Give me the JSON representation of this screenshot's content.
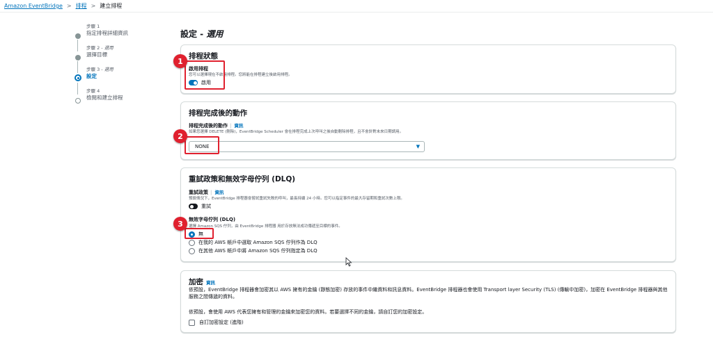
{
  "breadcrumb": {
    "service": "Amazon EventBridge",
    "section": "排程",
    "current": "建立排程",
    "separator": ">"
  },
  "steps": [
    {
      "step": "步驟 1",
      "title": "指定排程詳細資訊",
      "optional": ""
    },
    {
      "step": "步驟 2 - ",
      "title": "選擇目標",
      "optional": "選用"
    },
    {
      "step": "步驟 3 - ",
      "title": "設定",
      "optional": "選用"
    },
    {
      "step": "步驟 4",
      "title": "檢閱和建立排程",
      "optional": ""
    }
  ],
  "page": {
    "title": "設定 - ",
    "title_optional": "選用"
  },
  "schedule_state": {
    "heading": "排程狀態",
    "label": "啟用排程",
    "description": "您可以選擇現在不啟用排程。您將能在排程建立後啟用排程。",
    "toggle_label": "啟用",
    "enabled": true
  },
  "completion_action": {
    "heading": "排程完成後的動作",
    "label": "排程完成後的動作",
    "info": "資訊",
    "description": "如果您選擇 DELETE (刪除)，EventBridge Scheduler 會在排程完成上次呼叫之後自動刪除排程，且不會針對未來日期調用。",
    "selected": "NONE"
  },
  "retry_dlq": {
    "heading": "重試政策和無效字母佇列 (DLQ)",
    "retry_label": "重試政策",
    "info": "資訊",
    "retry_description": "預設情況下，EventBridge 排程器會嘗試重試失敗的呼叫，最長持續 24 小時。您可以指定事件的最大存留期和重試次數上限。",
    "retry_toggle": "重試",
    "retry_enabled": false,
    "dlq_label": "無效字母佇列 (DLQ)",
    "dlq_description": "選擇 Amazon SQS 佇列，由 EventBridge 排程器 用於存放無法成功傳遞至目標的事件。",
    "options": [
      "無",
      "在我的 AWS 帳戶中選取 Amazon SQS 佇列作為 DLQ",
      "在其他 AWS 帳戶中將 Amazon SQS 佇列指定為 DLQ"
    ],
    "selected_index": 0
  },
  "encryption": {
    "heading": "加密",
    "info": "資訊",
    "paragraph1": "依預設，EventBridge 排程器會加密其以 AWS 擁有的金鑰 (靜態加密) 存放的事件中繼資料和訊息資料。EventBridge 排程器也會使用 Transport layer Security (TLS) (傳輸中加密)，加密在 EventBridge 排程器與其他服務之間傳遞的資料。",
    "paragraph2": "依預設，會使用 AWS 代表您擁有和管理的金鑰來加密您的資料。若要選擇不同的金鑰，請自訂您的加密設定。",
    "checkbox_label": "自訂加密設定 (進階)"
  },
  "annotations": [
    "1",
    "2",
    "3"
  ],
  "colors": {
    "accent": "#0073bb",
    "annotation": "#e0202e"
  }
}
